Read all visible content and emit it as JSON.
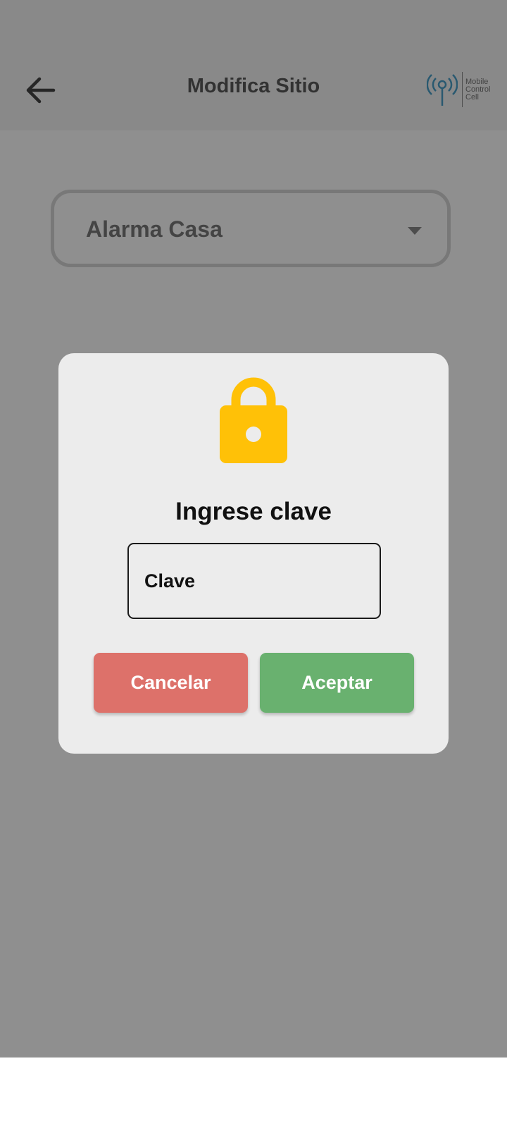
{
  "app_bar": {
    "title": "Modifica Sitio",
    "back_icon": "arrow-left-icon",
    "logo": {
      "icon": "antenna-icon",
      "line1": "Mobile",
      "line2": "Control",
      "line3": "Cell"
    }
  },
  "site_select": {
    "selected": "Alarma Casa",
    "caret_icon": "caret-down-icon"
  },
  "dialog": {
    "icon": "lock-icon",
    "title": "Ingrese clave",
    "input": {
      "placeholder": "Clave",
      "value": ""
    },
    "cancel_label": "Cancelar",
    "accept_label": "Aceptar"
  },
  "colors": {
    "lock": "#ffc107",
    "cancel": "#dd716a",
    "accept": "#69b16f",
    "dialog_bg": "#ececec"
  }
}
